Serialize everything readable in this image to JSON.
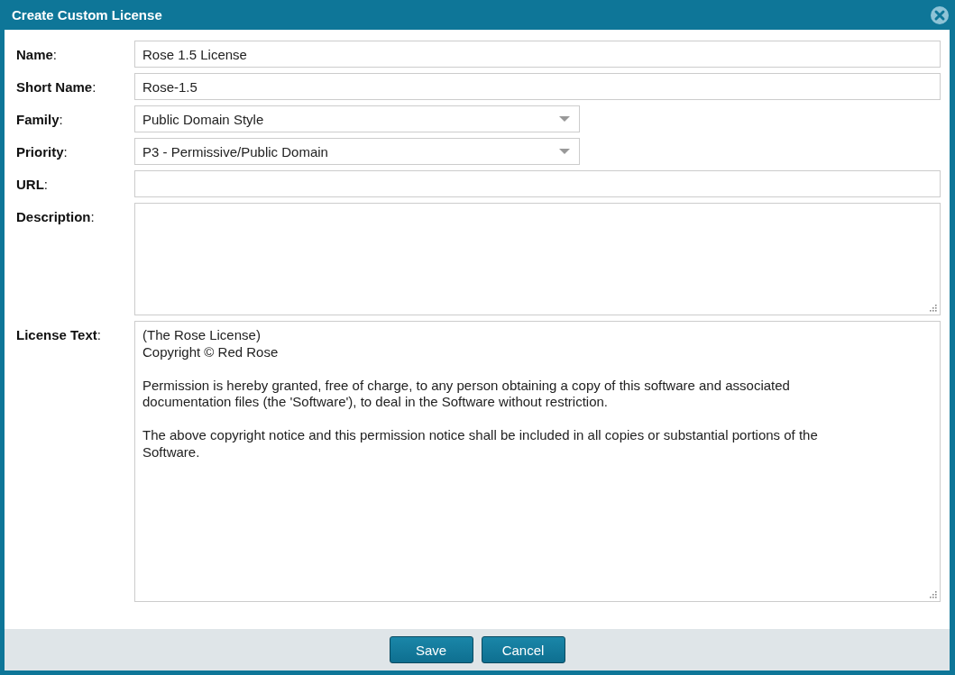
{
  "window": {
    "title": "Create Custom License"
  },
  "fields": [
    {
      "label": "**Name**:",
      "kind": "text",
      "value": "Rose 1.5 License"
    },
    {
      "label": "**Short Name**:",
      "kind": "text",
      "value": "Rose-1.5"
    },
    {
      "label": "**Family**:",
      "kind": "select",
      "value": "Public Domain Style"
    },
    {
      "label": "**Priority**:",
      "kind": "select",
      "value": "P3 - Permissive/Public Domain"
    },
    {
      "label": "**URL**:",
      "kind": "text"
    },
    {
      "label": "**Description**:",
      "kind": "textarea"
    },
    {
      "label": "**License Text**:",
      "kind": "textarea",
      "value": "(The Rose License)\nCopyright © Red Rose\n\nPermission is hereby granted, free of charge, to any person obtaining a copy of this software and associated documentation files (the 'Software'), to deal in the Software without restriction.\n\nThe above copyright notice and this permission notice shall be included in all copies or substantial portions of the Software."
    }
  ],
  "buttons": [
    "Save",
    "Cancel"
  ]
}
